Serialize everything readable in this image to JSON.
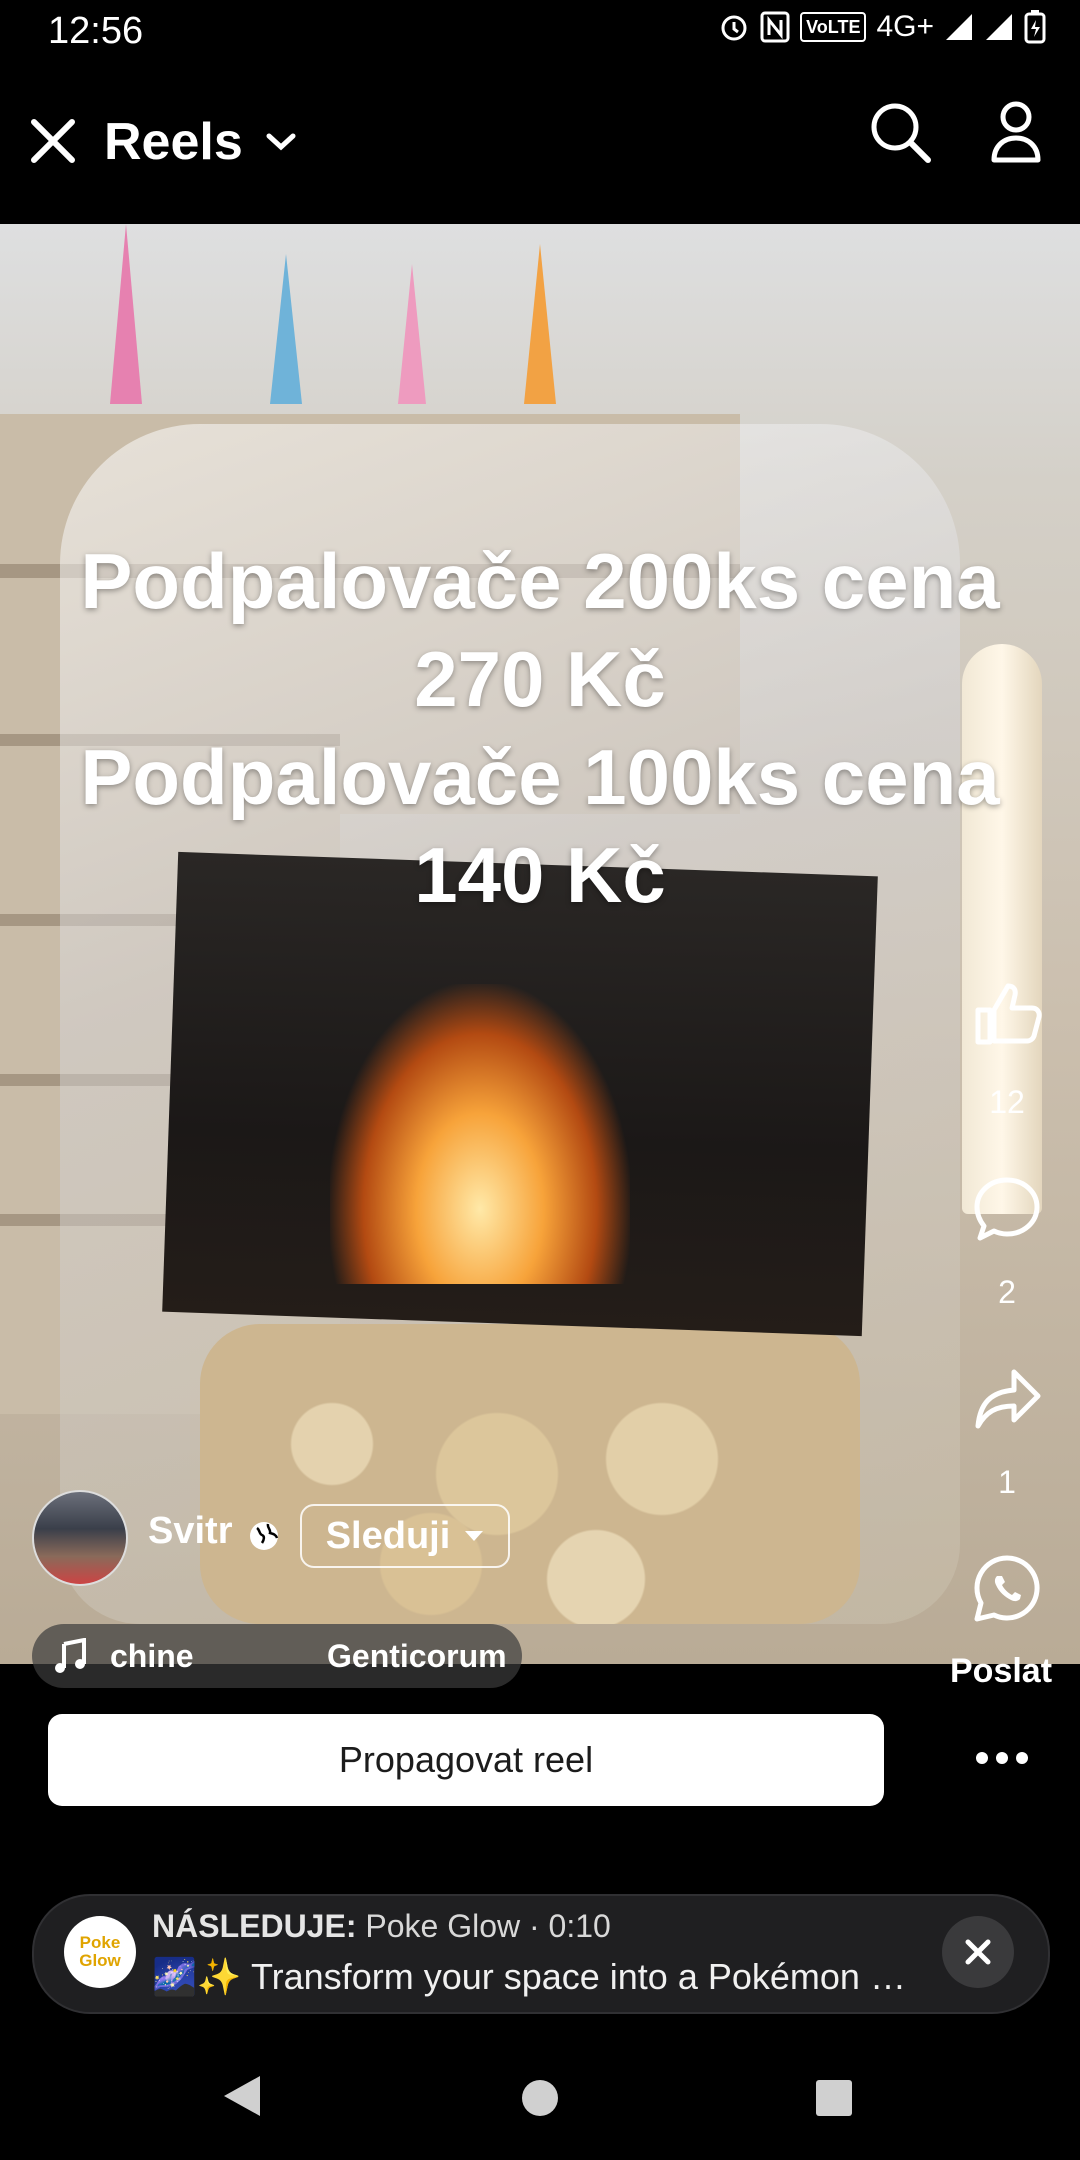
{
  "status_bar": {
    "time": "12:56",
    "network": "4G+",
    "volte": "VoLTE",
    "icons": [
      "alarm-icon",
      "nfc-icon",
      "volte-icon",
      "signal-icon",
      "signal-icon",
      "battery-icon"
    ]
  },
  "header": {
    "title": "Reels",
    "icons": [
      "close-icon",
      "chevron-down-icon",
      "search-icon",
      "profile-icon"
    ]
  },
  "video": {
    "caption": "Podpalovače 200ks cena\n270 Kč\nPodpalovače 100ks cena\n140 Kč"
  },
  "actions": {
    "like_count": "12",
    "comment_count": "2",
    "share_count": "1",
    "send_label": "Poslat"
  },
  "author": {
    "name": "Svitr",
    "follow_label": "Sleduji"
  },
  "music": {
    "left_text": "chine",
    "right_text": "Genticorum"
  },
  "promote": {
    "label": "Propagovat reel"
  },
  "up_next": {
    "prefix": "NÁSLEDUJE:",
    "channel": "Poke Glow",
    "separator": " · ",
    "duration": "0:10",
    "title": "🌌✨ Transform your space into a Pokémon wonderland",
    "avatar_text": "Poke Glow"
  },
  "colors": {
    "background": "#000000",
    "promote_bg": "#ffffff",
    "card_bg": "#1f1f21"
  }
}
